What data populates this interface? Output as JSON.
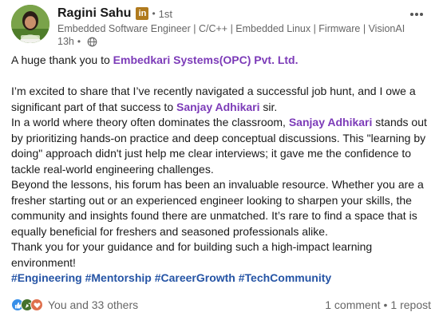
{
  "post": {
    "author": {
      "name": "Ragini Sahu",
      "badge": "in",
      "separator": "•",
      "connection_degree": "1st",
      "headline": "Embedded Software Engineer | C/C++ | Embedded Linux | Firmware | VisionAI",
      "time_ago": "13h",
      "time_separator": "•",
      "avatar_icon": "profile-photo",
      "visibility_icon": "globe-icon"
    },
    "more_icon": "ellipsis-icon",
    "body": {
      "p1_before": "A huge thank you to ",
      "p1_mention": "Embedkari Systems(OPC) Pvt. Ltd.",
      "p2_before": "I’m excited to share that I’ve recently navigated a successful job hunt, and I owe a significant part of that success to ",
      "p2_mention": "Sanjay Adhikari",
      "p2_after": " sir.",
      "p3_before": "In a world where theory often dominates the classroom, ",
      "p3_mention": "Sanjay Adhikari",
      "p3_after": " stands out by prioritizing hands-on practice and deep conceptual discussions. This \"learning by doing\" approach didn't just help me clear interviews; it gave me the confidence to tackle real-world engineering challenges.",
      "p4": "Beyond the lessons, his forum has been an invaluable resource. Whether you are a fresher starting out or an experienced engineer looking to sharpen your skills, the community and insights found there are unmatched. It’s rare to find a space that is equally beneficial for freshers and seasoned professionals alike.",
      "p5": "Thank you for your guidance and for building such a high-impact learning environment!",
      "hashtags": [
        "#Engineering",
        "#Mentorship",
        "#CareerGrowth",
        "#TechCommunity"
      ]
    },
    "social": {
      "reactions": [
        "like-icon",
        "celebrate-icon",
        "love-icon"
      ],
      "reaction_text": "You and 33 others",
      "comments": "1 comment",
      "separator": "•",
      "reposts": "1 repost"
    }
  },
  "colors": {
    "mention": "#7c3bb8",
    "hashtag": "#2554a5",
    "muted": "#666666",
    "text": "#191919",
    "badge": "#b07a1d",
    "like": "#378fe9",
    "celebrate": "#44712e",
    "love": "#df704d"
  }
}
